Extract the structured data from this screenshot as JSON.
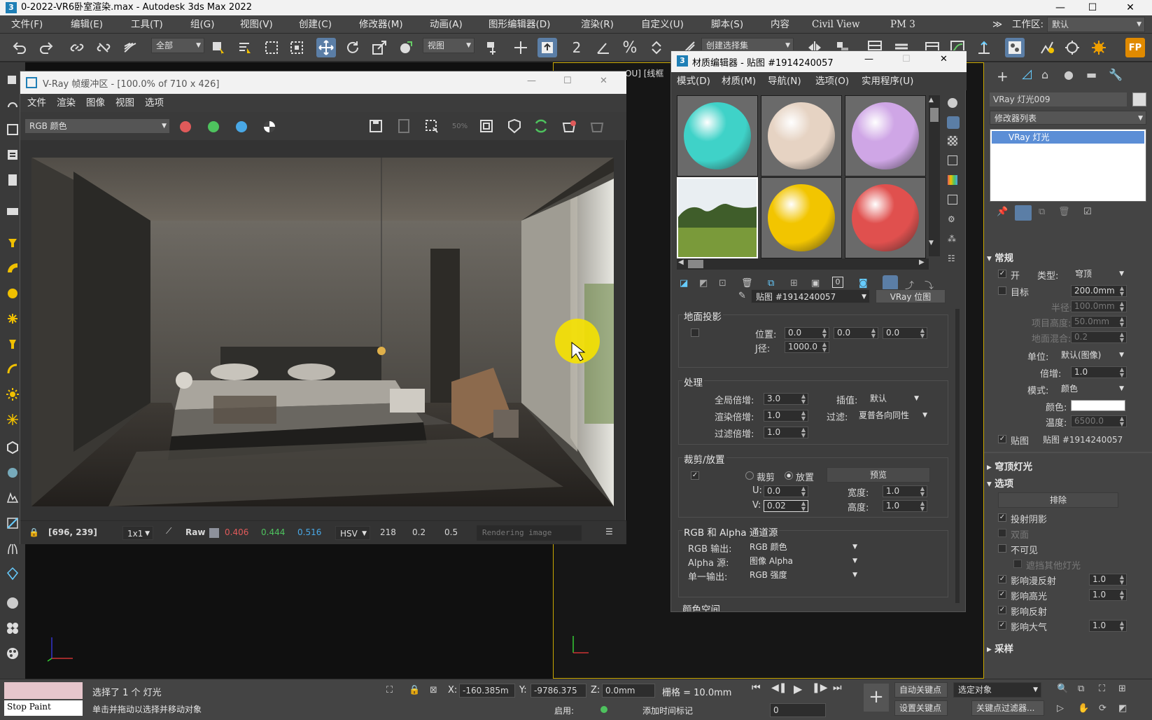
{
  "app": {
    "title": "0-2022-VR6卧室渲染.max - Autodesk 3ds Max 2022",
    "logo": "3"
  },
  "menubar": {
    "items": [
      "文件(F)",
      "编辑(E)",
      "工具(T)",
      "组(G)",
      "视图(V)",
      "创建(C)",
      "修改器(M)",
      "动画(A)",
      "图形编辑器(D)",
      "渲染(R)",
      "自定义(U)",
      "脚本(S)",
      "内容",
      "Civil View",
      "PM 3"
    ],
    "workspace_label": "工作区:",
    "workspace_value": "默认"
  },
  "toolbar": {
    "filter": "全部",
    "view": "视图",
    "selset": "创建选择集",
    "angle": "2",
    "snap_pct": "%"
  },
  "vfb": {
    "title": "V-Ray 帧缓冲区 - [100.0% of 710 x 426]",
    "menu": [
      "文件",
      "渲染",
      "图像",
      "视图",
      "选项"
    ],
    "channel": "RGB 颜色",
    "status": {
      "coords": "[696, 239]",
      "zoom": "1x1",
      "raw": "Raw",
      "r": "0.406",
      "g": "0.444",
      "b": "0.516",
      "mode": "HSV",
      "h": "218",
      "s": "0.2",
      "v": "0.5",
      "msg": "Rendering image"
    }
  },
  "mated": {
    "title": "材质编辑器 - 贴图 #1914240057",
    "menu": [
      "模式(D)",
      "材质(M)",
      "导航(N)",
      "选项(O)",
      "实用程序(U)"
    ],
    "slots": [
      {
        "color": "#3fd2c8"
      },
      {
        "color": "#e6d3c3"
      },
      {
        "color": "#cfa6e6"
      },
      {
        "color": "landscape"
      },
      {
        "color": "#f2c500"
      },
      {
        "color": "#e0504e"
      }
    ],
    "map_name": "贴图 #1914240057",
    "map_type": "VRay 位图",
    "ground": {
      "title": "地面投影",
      "pos_label": "位置:",
      "pos": [
        "0.0",
        "0.0",
        "0.0"
      ],
      "radius_label": "J径:",
      "radius": "1000.0"
    },
    "proc": {
      "title": "处理",
      "gmul_label": "全局倍增:",
      "gmul": "3.0",
      "interp_label": "插值:",
      "interp": "默认",
      "rmul_label": "渲染倍增:",
      "rmul": "1.0",
      "filter_label": "过滤:",
      "filter": "夏普各向同性",
      "fmul_label": "过滤倍增:",
      "fmul": "1.0"
    },
    "crop": {
      "title": "裁剪/放置",
      "crop": "裁剪",
      "place": "放置",
      "preview": "预览",
      "u_label": "U:",
      "u": "0.0",
      "v_label": "V:",
      "v": "0.02",
      "w_label": "宽度:",
      "w": "1.0",
      "h_label": "高度:",
      "h": "1.0"
    },
    "rgba": {
      "title": "RGB 和 Alpha 通道源",
      "rgb_label": "RGB 输出:",
      "rgb": "RGB 颜色",
      "alpha_label": "Alpha 源:",
      "alpha": "图像 Alpha",
      "mono_label": "单一输出:",
      "mono": "RGB 强度"
    },
    "cs": "颜色空间"
  },
  "viewport2": {
    "label": "OU] [线框"
  },
  "cmd": {
    "object": "VRay 灯光009",
    "modlist": "修改器列表",
    "stack_item": "VRay 灯光",
    "general": {
      "title": "常规",
      "on": "开",
      "type_label": "类型:",
      "type": "穹顶",
      "target": "目标",
      "target_val": "200.0mm",
      "radius_label": "半径:",
      "radius": "100.0mm",
      "h_label": "项目高度:",
      "h": "50.0mm",
      "blend_label": "地面混合:",
      "blend": "0.2",
      "unit_label": "单位:",
      "unit": "默认(图像)",
      "mult_label": "倍增:",
      "mult": "1.0",
      "mode_label": "模式:",
      "mode": "颜色",
      "color_label": "颜色:",
      "temp_label": "温度:",
      "temp": "6500.0",
      "tex": "贴图",
      "tex_val": "贴图 #1914240057"
    },
    "dome": "穹顶灯光",
    "options": {
      "title": "选项",
      "exclude": "排除",
      "cast": "投射阴影",
      "double": "双面",
      "invis": "不可见",
      "occlude": "遮挡其他灯光",
      "diffuse": "影响漫反射",
      "diffuse_v": "1.0",
      "spec": "影响高光",
      "spec_v": "1.0",
      "refl": "影响反射",
      "atmo": "影响大气",
      "atmo_v": "1.0"
    },
    "sampling": "采样"
  },
  "bottom": {
    "status1": "选择了 1 个 灯光",
    "status2": "单击并拖动以选择并移动对象",
    "script": "Stop Paint",
    "x_label": "X:",
    "x": "-160.385m",
    "y_label": "Y:",
    "y": "-9786.375",
    "z_label": "Z:",
    "z": "0.0mm",
    "grid": "栅格 = 10.0mm",
    "autokey": "自动关键点",
    "setkey": "设置关键点",
    "selobj": "选定对象",
    "keyfilter": "关键点过滤器...",
    "enable": "启用:",
    "addtime": "添加时间标记",
    "frame": "0"
  }
}
